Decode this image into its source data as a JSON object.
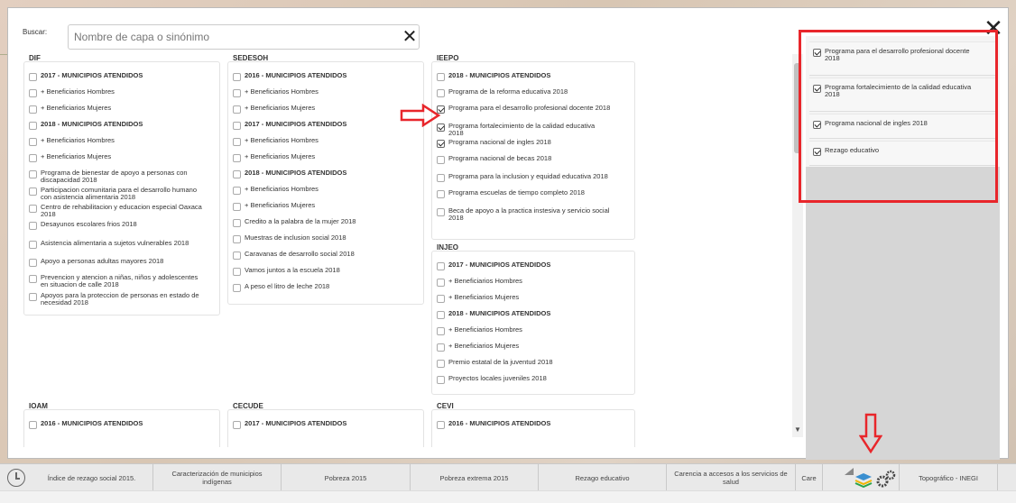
{
  "search": {
    "label": "Buscar:",
    "placeholder": "Nombre de capa o sinónimo",
    "value": "",
    "clear_icon": "close-icon"
  },
  "modal": {
    "close_icon": "close-icon"
  },
  "groups": {
    "dif": {
      "title": "DIF",
      "items": [
        {
          "label": "2017 - MUNICIPIOS ATENDIDOS",
          "bold": true,
          "checked": false
        },
        {
          "label": "+ Beneficiarios Hombres",
          "bold": false,
          "checked": false
        },
        {
          "label": "+ Beneficiarios Mujeres",
          "bold": false,
          "checked": false
        },
        {
          "label": "2018 - MUNICIPIOS ATENDIDOS",
          "bold": true,
          "checked": false
        },
        {
          "label": "+ Beneficiarios Hombres",
          "bold": false,
          "checked": false
        },
        {
          "label": "+ Beneficiarios Mujeres",
          "bold": false,
          "checked": false
        },
        {
          "label": "Programa de bienestar de apoyo a personas con discapacidad 2018",
          "bold": false,
          "checked": false
        },
        {
          "label": "Participacion comunitaria para el desarrollo humano con asistencia alimentaria 2018",
          "bold": false,
          "checked": false
        },
        {
          "label": "Centro de rehabilitacion y educacion especial Oaxaca 2018",
          "bold": false,
          "checked": false
        },
        {
          "label": "Desayunos escolares frios 2018",
          "bold": false,
          "checked": false
        },
        {
          "label": "Asistencia alimentaria a sujetos vulnerables 2018",
          "bold": false,
          "checked": false
        },
        {
          "label": "Apoyo a personas adultas mayores 2018",
          "bold": false,
          "checked": false
        },
        {
          "label": "Prevencion y atencion a niñas, niños y adolescentes en situacion de calle 2018",
          "bold": false,
          "checked": false
        },
        {
          "label": "Apoyos para la proteccion de personas en estado de necesidad 2018",
          "bold": false,
          "checked": false
        }
      ]
    },
    "sedesoh": {
      "title": "SEDESOH",
      "items": [
        {
          "label": "2016 - MUNICIPIOS ATENDIDOS",
          "bold": true,
          "checked": false
        },
        {
          "label": "+ Beneficiarios Hombres",
          "bold": false,
          "checked": false
        },
        {
          "label": "+ Beneficiarios Mujeres",
          "bold": false,
          "checked": false
        },
        {
          "label": "2017 - MUNICIPIOS ATENDIDOS",
          "bold": true,
          "checked": false
        },
        {
          "label": "+ Beneficiarios Hombres",
          "bold": false,
          "checked": false
        },
        {
          "label": "+ Beneficiarios Mujeres",
          "bold": false,
          "checked": false
        },
        {
          "label": "2018 - MUNICIPIOS ATENDIDOS",
          "bold": true,
          "checked": false
        },
        {
          "label": "+ Beneficiarios Hombres",
          "bold": false,
          "checked": false
        },
        {
          "label": "+ Beneficiarios Mujeres",
          "bold": false,
          "checked": false
        },
        {
          "label": "Credito a la palabra de la mujer 2018",
          "bold": false,
          "checked": false
        },
        {
          "label": "Muestras de inclusion social 2018",
          "bold": false,
          "checked": false
        },
        {
          "label": "Caravanas de desarrollo social 2018",
          "bold": false,
          "checked": false
        },
        {
          "label": "Vamos juntos a la escuela 2018",
          "bold": false,
          "checked": false
        },
        {
          "label": "A peso el litro de leche 2018",
          "bold": false,
          "checked": false
        }
      ]
    },
    "ieepo": {
      "title": "IEEPO",
      "items": [
        {
          "label": "2018 - MUNICIPIOS ATENDIDOS",
          "bold": true,
          "checked": false
        },
        {
          "label": "Programa de la reforma educativa 2018",
          "bold": false,
          "checked": false
        },
        {
          "label": "Programa para el desarrollo profesional docente 2018",
          "bold": false,
          "checked": true
        },
        {
          "label": "Programa fortalecimiento de la calidad educativa 2018",
          "bold": false,
          "checked": true
        },
        {
          "label": "Programa nacional de ingles 2018",
          "bold": false,
          "checked": true
        },
        {
          "label": "Programa nacional de becas 2018",
          "bold": false,
          "checked": false
        },
        {
          "label": "Programa para la inclusion y equidad educativa 2018",
          "bold": false,
          "checked": false
        },
        {
          "label": "Programa escuelas de tiempo completo 2018",
          "bold": false,
          "checked": false
        },
        {
          "label": "Beca de apoyo a la practica instesiva y servicio social 2018",
          "bold": false,
          "checked": false
        }
      ]
    },
    "injeo": {
      "title": "INJEO",
      "items": [
        {
          "label": "2017 - MUNICIPIOS ATENDIDOS",
          "bold": true,
          "checked": false
        },
        {
          "label": "+ Beneficiarios Hombres",
          "bold": false,
          "checked": false
        },
        {
          "label": "+ Beneficiarios Mujeres",
          "bold": false,
          "checked": false
        },
        {
          "label": "2018 - MUNICIPIOS ATENDIDOS",
          "bold": true,
          "checked": false
        },
        {
          "label": "+ Beneficiarios Hombres",
          "bold": false,
          "checked": false
        },
        {
          "label": "+ Beneficiarios Mujeres",
          "bold": false,
          "checked": false
        },
        {
          "label": "Premio estatal de la juventud 2018",
          "bold": false,
          "checked": false
        },
        {
          "label": "Proyectos locales juveniles 2018",
          "bold": false,
          "checked": false
        }
      ]
    },
    "ioam": {
      "title": "IOAM",
      "items": [
        {
          "label": "2016 - MUNICIPIOS ATENDIDOS",
          "bold": true,
          "checked": false
        }
      ]
    },
    "cecude": {
      "title": "CECUDE",
      "items": [
        {
          "label": "2017 - MUNICIPIOS ATENDIDOS",
          "bold": true,
          "checked": false
        }
      ]
    },
    "cevi": {
      "title": "CEVI",
      "items": [
        {
          "label": "2016 - MUNICIPIOS ATENDIDOS",
          "bold": true,
          "checked": false
        }
      ]
    }
  },
  "selected_layers": [
    {
      "label": "Programa para el desarrollo profesional docente 2018",
      "checked": true
    },
    {
      "label": "Programa fortalecimiento de la calidad educativa 2018",
      "checked": true
    },
    {
      "label": "Programa nacional de ingles 2018",
      "checked": true
    },
    {
      "label": "Rezago educativo",
      "checked": true
    }
  ],
  "bottom_tabs": [
    {
      "label": "Índice de rezago social 2015."
    },
    {
      "label": "Caracterización de municipios indígenas"
    },
    {
      "label": "Pobreza 2015"
    },
    {
      "label": "Pobreza extrema 2015"
    },
    {
      "label": "Rezago educativo"
    },
    {
      "label": "Carencia a accesos a los servicios de salud"
    },
    {
      "label": "Care"
    }
  ],
  "basemap_label": "Topográfico - INEGI",
  "colors": {
    "highlight": "#e8262b",
    "arrow": "#e8262b"
  },
  "icons": [
    "clock-icon",
    "layers-icon",
    "settings-gears-icon",
    "close-icon",
    "arrow-right-icon",
    "arrow-down-icon"
  ]
}
